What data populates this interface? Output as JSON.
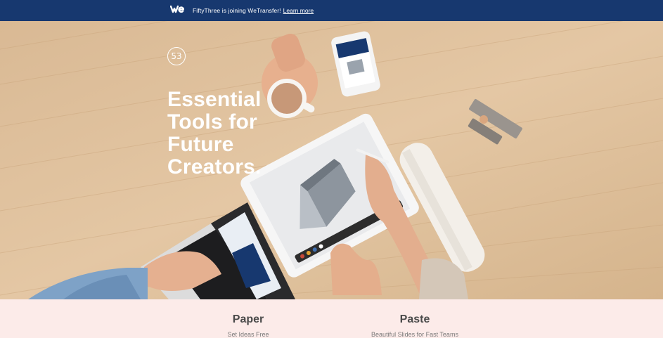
{
  "banner": {
    "logo_alt": "we",
    "message": "FiftyThree is joining WeTransfer!",
    "link": "Learn more",
    "bg_color": "#17386f"
  },
  "hero": {
    "logo_text": "53",
    "headline_lines": [
      "Essential",
      "Tools for",
      "Future",
      "Creators."
    ]
  },
  "products": [
    {
      "name": "Paper",
      "tagline": "Set Ideas Free"
    },
    {
      "name": "Paste",
      "tagline": "Beautiful Slides for Fast Teams"
    }
  ]
}
